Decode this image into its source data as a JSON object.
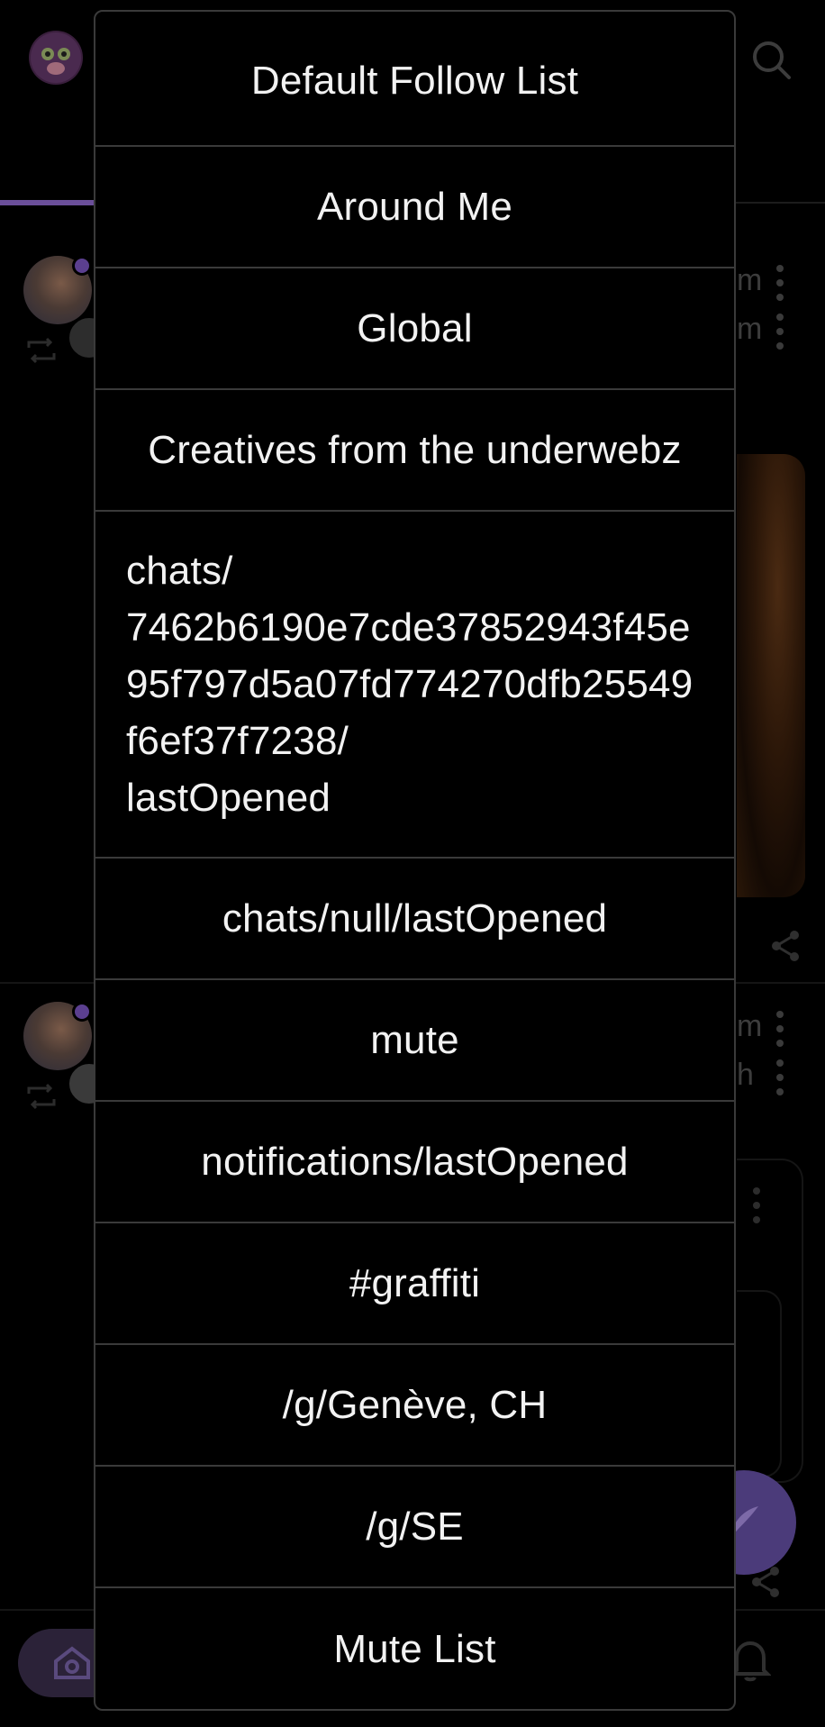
{
  "menu": {
    "items": [
      {
        "label": "Default Follow List"
      },
      {
        "label": "Around Me"
      },
      {
        "label": "Global"
      },
      {
        "label": "Creatives from the underwebz"
      },
      {
        "label": "chats/\n7462b6190e7cde37852943f45e95f797d5a07fd774270dfb25549f6ef37f7238/\nlastOpened"
      },
      {
        "label": "chats/null/lastOpened"
      },
      {
        "label": "mute"
      },
      {
        "label": "notifications/lastOpened"
      },
      {
        "label": "#graffiti"
      },
      {
        "label": "/g/Genève, CH"
      },
      {
        "label": "/g/SE"
      },
      {
        "label": "Mute List"
      }
    ]
  },
  "background": {
    "post1": {
      "time_top": "m",
      "time_bottom": "m"
    },
    "post2": {
      "time_top": "m",
      "time_bottom": "h"
    }
  },
  "colors": {
    "accent": "#6b4f9a",
    "fab": "#4b3b7a",
    "menu_border": "#3a3a3a",
    "menu_text": "#f2f2f2"
  },
  "icons": {
    "logo": "monkey-logo-icon",
    "search": "search-icon",
    "repost": "repost-icon",
    "more": "kebab-icon",
    "share": "share-icon",
    "compose": "quill-icon",
    "home": "home-icon",
    "notifications": "bell-icon"
  }
}
